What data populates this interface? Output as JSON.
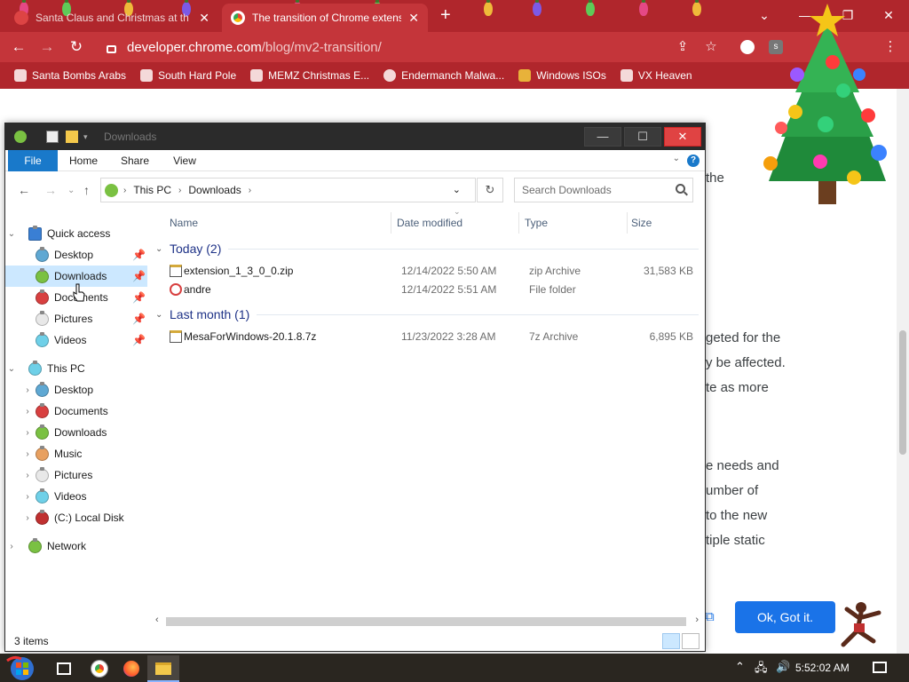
{
  "browser": {
    "tabs": [
      {
        "title": "Santa Claus and Christmas at th",
        "active": false
      },
      {
        "title": "The transition of Chrome extensi",
        "active": true
      }
    ],
    "address": {
      "host": "developer.chrome.com",
      "path": "/blog/mv2-transition/"
    },
    "bookmarks": [
      "Santa Bombs Arabs",
      "South Hard Pole",
      "MEMZ Christmas E...",
      "Endermanch Malwa...",
      "Windows ISOs",
      "VX Heaven"
    ],
    "page_fragments": [
      "the",
      "geted for the",
      "y be affected.",
      "te as more",
      "e needs and",
      "umber of",
      "to the new",
      "tiple static"
    ],
    "cookie_button": "Ok, Got it.",
    "accent": "#c4353a"
  },
  "explorer": {
    "title": "Downloads",
    "ribbon_tabs": [
      "File",
      "Home",
      "Share",
      "View"
    ],
    "help": "?",
    "breadcrumb": [
      "This PC",
      "Downloads"
    ],
    "search_placeholder": "Search Downloads",
    "nav": {
      "quick_access": {
        "label": "Quick access",
        "items": [
          "Desktop",
          "Downloads",
          "Documents",
          "Pictures",
          "Videos"
        ]
      },
      "this_pc": {
        "label": "This PC",
        "items": [
          "Desktop",
          "Documents",
          "Downloads",
          "Music",
          "Pictures",
          "Videos",
          "(C:) Local Disk"
        ]
      },
      "network": "Network"
    },
    "columns": [
      "Name",
      "Date modified",
      "Type",
      "Size"
    ],
    "groups": [
      {
        "label": "Today (2)",
        "files": [
          {
            "name": "extension_1_3_0_0.zip",
            "date": "12/14/2022 5:50 AM",
            "type": "zip Archive",
            "size": "31,583 KB"
          },
          {
            "name": "andre",
            "date": "12/14/2022 5:51 AM",
            "type": "File folder",
            "size": ""
          }
        ]
      },
      {
        "label": "Last month (1)",
        "files": [
          {
            "name": "MesaForWindows-20.1.8.7z",
            "date": "11/23/2022 3:28 AM",
            "type": "7z Archive",
            "size": "6,895 KB"
          }
        ]
      }
    ],
    "status": "3 items"
  },
  "taskbar": {
    "clock": "5:52:02 AM"
  }
}
